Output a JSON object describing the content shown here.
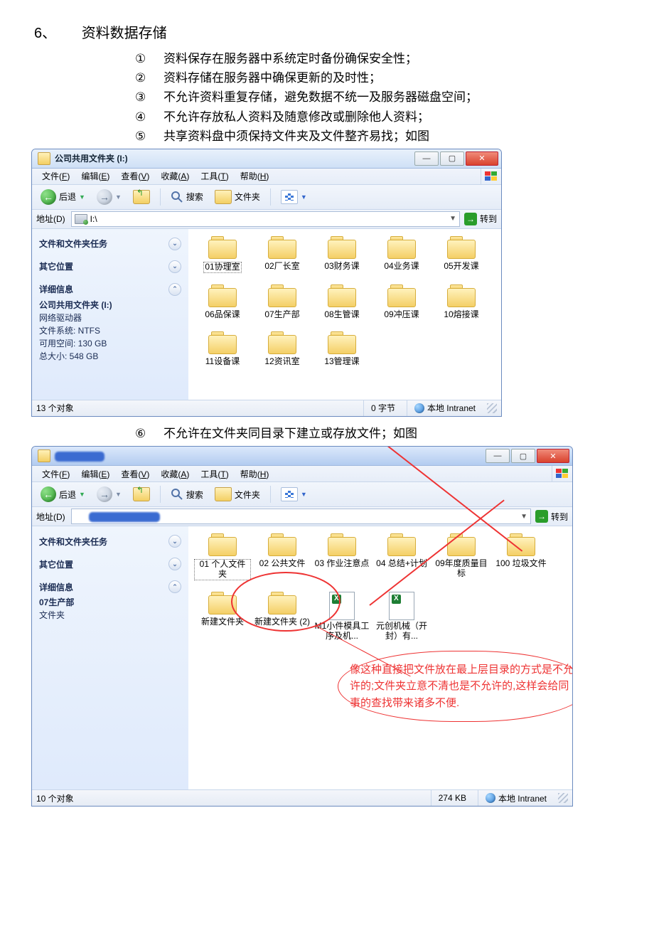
{
  "heading": {
    "num": "6、",
    "text": "资料数据存储"
  },
  "bullets": [
    {
      "mark": "①",
      "text": "资料保存在服务器中系统定时备份确保安全性；"
    },
    {
      "mark": "②",
      "text": "资料存储在服务器中确保更新的及时性；"
    },
    {
      "mark": "③",
      "text": "不允许资料重复存储，避免数据不统一及服务器磁盘空间；"
    },
    {
      "mark": "④",
      "text": "不允许存放私人资料及随意修改或删除他人资料；"
    },
    {
      "mark": "⑤",
      "text": "共享资料盘中须保持文件夹及文件整齐易找；如图"
    }
  ],
  "bullets2": [
    {
      "mark": "⑥",
      "text": "不允许在文件夹同目录下建立或存放文件；如图"
    }
  ],
  "win1": {
    "title": "公司共用文件夹 (I:)",
    "menus": [
      {
        "t": "文件",
        "u": "F"
      },
      {
        "t": "编辑",
        "u": "E"
      },
      {
        "t": "查看",
        "u": "V"
      },
      {
        "t": "收藏",
        "u": "A"
      },
      {
        "t": "工具",
        "u": "T"
      },
      {
        "t": "帮助",
        "u": "H"
      }
    ],
    "toolbar": {
      "back": "后退",
      "search": "搜索",
      "folders": "文件夹"
    },
    "addr": {
      "label": "地址(D)",
      "path": "I:\\",
      "go": "转到"
    },
    "side": {
      "tasks": "文件和文件夹任务",
      "other": "其它位置",
      "details": "详细信息",
      "info_title": "公司共用文件夹 (I:)",
      "info_sub": "网络驱动器",
      "fs": "文件系统: NTFS",
      "free": "可用空间: 130 GB",
      "total": "总大小: 548 GB"
    },
    "items": [
      "01协理室",
      "02厂长室",
      "03财务课",
      "04业务课",
      "05开发课",
      "06品保课",
      "07生产部",
      "08生管课",
      "09冲压课",
      "10熔接课",
      "11设备课",
      "12资讯室",
      "13管理课"
    ],
    "status": {
      "objects": "13 个对象",
      "bytes": "0 字节",
      "zone": "本地 Intranet"
    }
  },
  "win2": {
    "title": "",
    "menus": [
      {
        "t": "文件",
        "u": "F"
      },
      {
        "t": "编辑",
        "u": "E"
      },
      {
        "t": "查看",
        "u": "V"
      },
      {
        "t": "收藏",
        "u": "A"
      },
      {
        "t": "工具",
        "u": "T"
      },
      {
        "t": "帮助",
        "u": "H"
      }
    ],
    "toolbar": {
      "back": "后退",
      "search": "搜索",
      "folders": "文件夹"
    },
    "addr": {
      "label": "地址(D)",
      "go": "转到"
    },
    "side": {
      "tasks": "文件和文件夹任务",
      "other": "其它位置",
      "details": "详细信息",
      "info_title": "07生产部",
      "info_sub": "文件夹"
    },
    "items": [
      {
        "type": "folder",
        "label": "01 个人文件夹"
      },
      {
        "type": "folder",
        "label": "02 公共文件"
      },
      {
        "type": "folder",
        "label": "03 作业注意点"
      },
      {
        "type": "folder",
        "label": "04 总结+计划"
      },
      {
        "type": "folder",
        "label": "09年度质量目标"
      },
      {
        "type": "folder",
        "label": "100 垃圾文件"
      },
      {
        "type": "folder",
        "label": "新建文件夹"
      },
      {
        "type": "folder",
        "label": "新建文件夹 (2)"
      },
      {
        "type": "excel",
        "label": "M1小件模具工序及机..."
      },
      {
        "type": "excel",
        "label": "元创机械（开封）有..."
      }
    ],
    "status": {
      "objects": "10 个对象",
      "bytes": "274 KB",
      "zone": "本地 Intranet"
    },
    "callout": "像这种直接把文件放在最上层目录的方式是不允许的;文件夹立意不清也是不允许的,这样会给同事的查找带来诸多不便."
  }
}
